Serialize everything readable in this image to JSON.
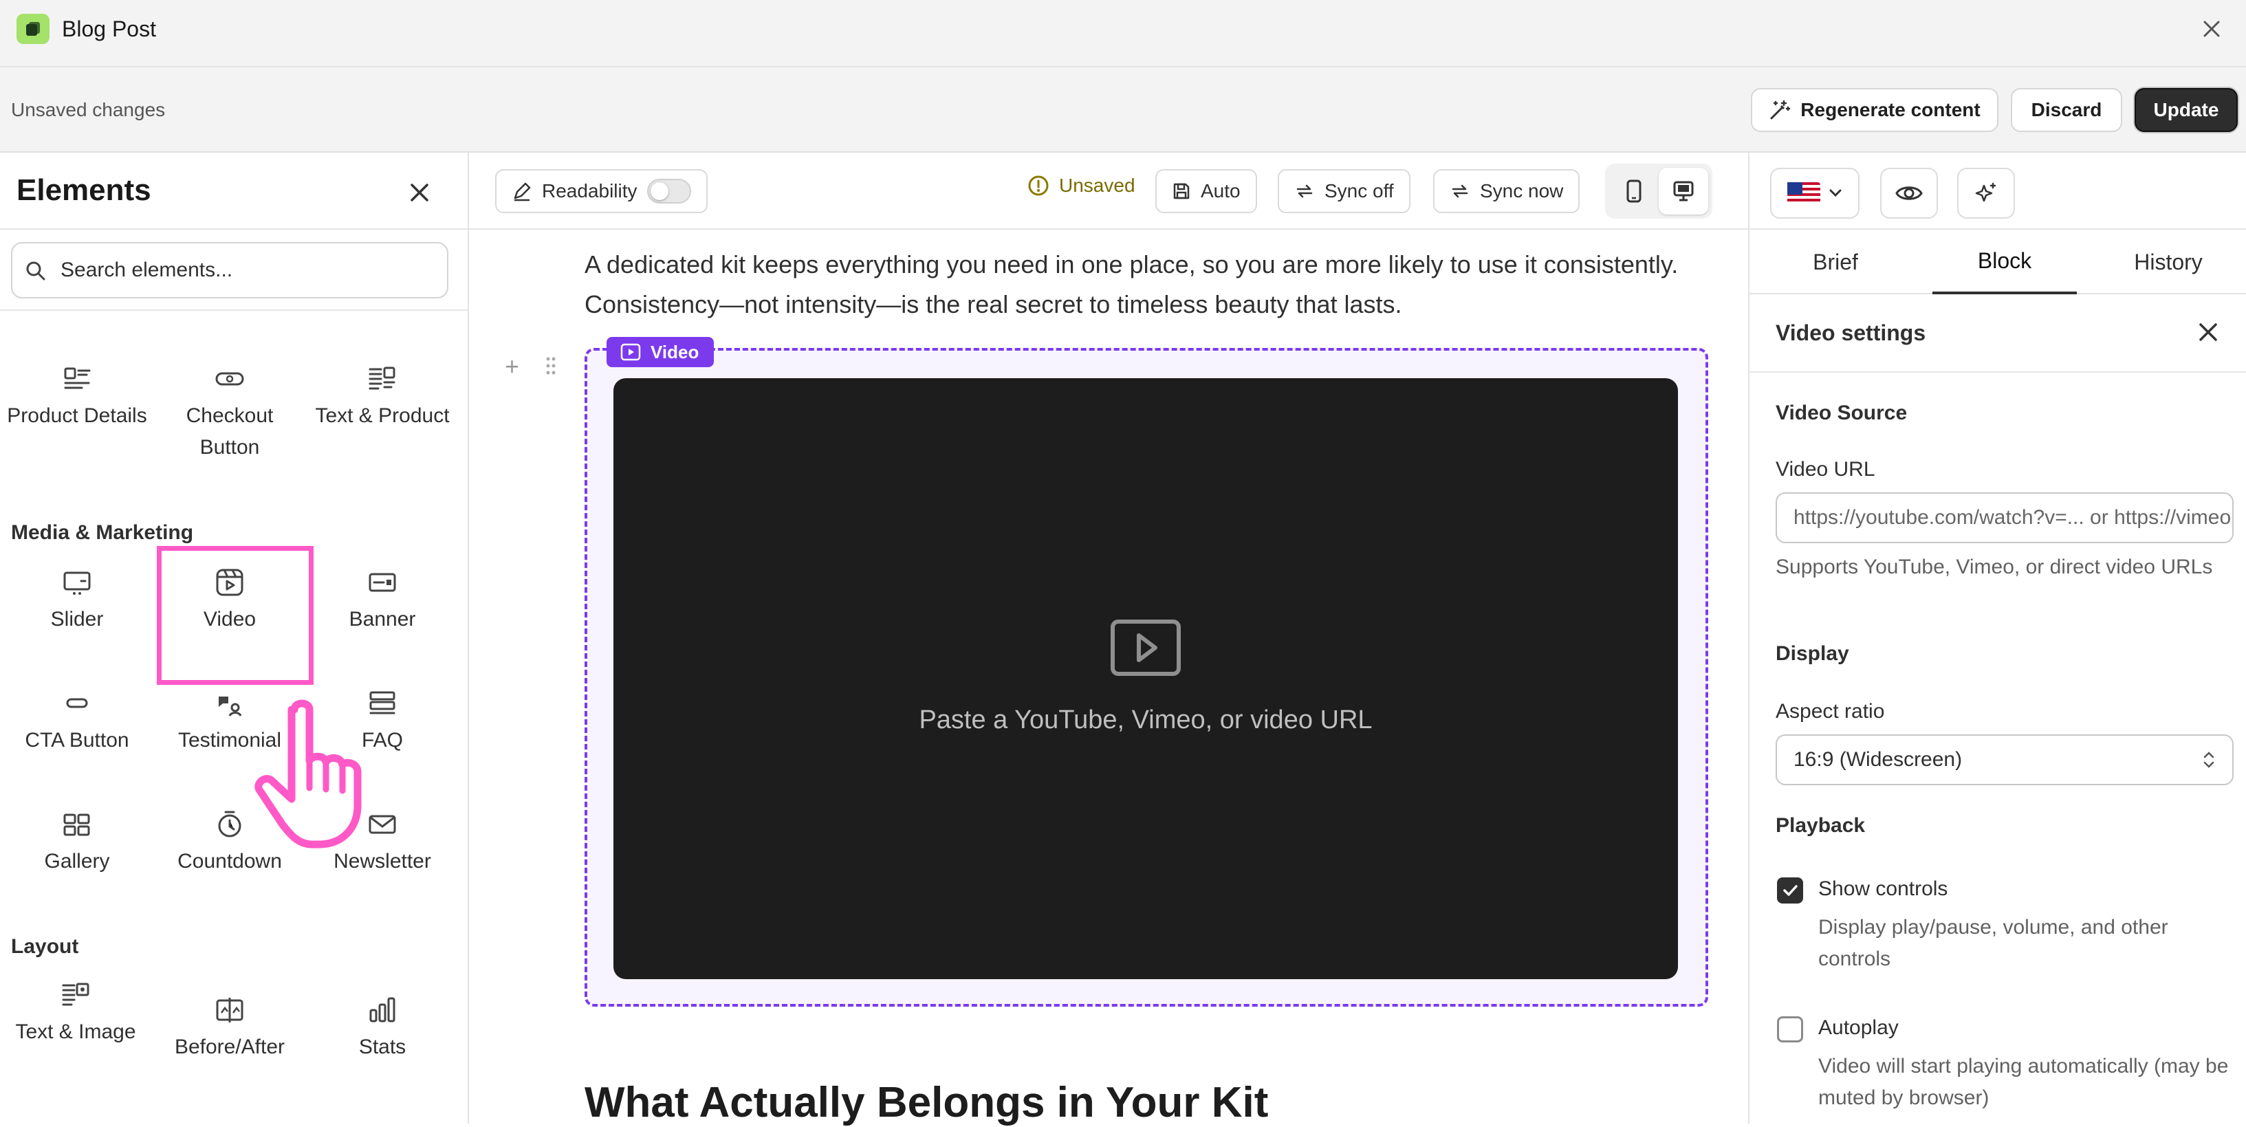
{
  "app": {
    "title": "Blog Post"
  },
  "actionbar": {
    "status": "Unsaved changes",
    "regenerate_label": "Regenerate content",
    "discard_label": "Discard",
    "update_label": "Update"
  },
  "sidebar": {
    "title": "Elements",
    "search_placeholder": "Search elements...",
    "row_items": [
      {
        "label": "Product Details",
        "icon": "product-details-icon"
      },
      {
        "label": "Checkout Button",
        "icon": "checkout-button-icon"
      },
      {
        "label": "Text & Product",
        "icon": "text-product-icon"
      }
    ],
    "media_section": "Media & Marketing",
    "media_items": [
      {
        "label": "Slider",
        "icon": "slider-icon"
      },
      {
        "label": "Video",
        "icon": "video-icon"
      },
      {
        "label": "Banner",
        "icon": "banner-icon"
      },
      {
        "label": "CTA Button",
        "icon": "cta-button-icon"
      },
      {
        "label": "Testimonial",
        "icon": "testimonial-icon"
      },
      {
        "label": "FAQ",
        "icon": "faq-icon"
      },
      {
        "label": "Gallery",
        "icon": "gallery-icon"
      },
      {
        "label": "Countdown",
        "icon": "countdown-icon"
      },
      {
        "label": "Newsletter",
        "icon": "newsletter-icon"
      }
    ],
    "layout_section": "Layout",
    "layout_items": [
      {
        "label": "Text & Image",
        "icon": "text-image-icon"
      },
      {
        "label": "Before/After",
        "icon": "before-after-icon"
      },
      {
        "label": "Stats",
        "icon": "stats-icon"
      }
    ]
  },
  "editor": {
    "readability_label": "Readability",
    "readability_on": false,
    "unsaved_label": "Unsaved",
    "auto_label": "Auto",
    "sync_off_label": "Sync off",
    "sync_now_label": "Sync now",
    "paragraph": "A dedicated kit keeps everything you need in one place, so you are more likely to use it consistently. Consistency—not intensity—is the real secret to timeless beauty that lasts.",
    "video_tag": "Video",
    "video_placeholder": "Paste a YouTube, Vimeo, or video URL",
    "heading": "What Actually Belongs in Your Kit"
  },
  "right_panel": {
    "tabs": [
      "Brief",
      "Block",
      "History"
    ],
    "active_tab": "Block",
    "settings_title": "Video settings",
    "video_source_heading": "Video Source",
    "video_url_label": "Video URL",
    "video_url_placeholder": "https://youtube.com/watch?v=... or https://vimeo.com/...",
    "video_url_help": "Supports YouTube, Vimeo, or direct video URLs",
    "display_heading": "Display",
    "aspect_label": "Aspect ratio",
    "aspect_value": "16:9 (Widescreen)",
    "playback_heading": "Playback",
    "show_controls_label": "Show controls",
    "show_controls_checked": true,
    "show_controls_help": "Display play/pause, volume, and other controls",
    "autoplay_label": "Autoplay",
    "autoplay_checked": false,
    "autoplay_help": "Video will start playing automatically (may be muted by browser)"
  },
  "colors": {
    "accent": "#7c3aed",
    "highlight": "#ff59c7",
    "logo": "#a4e26a",
    "dark_button": "#2d2d2d"
  }
}
